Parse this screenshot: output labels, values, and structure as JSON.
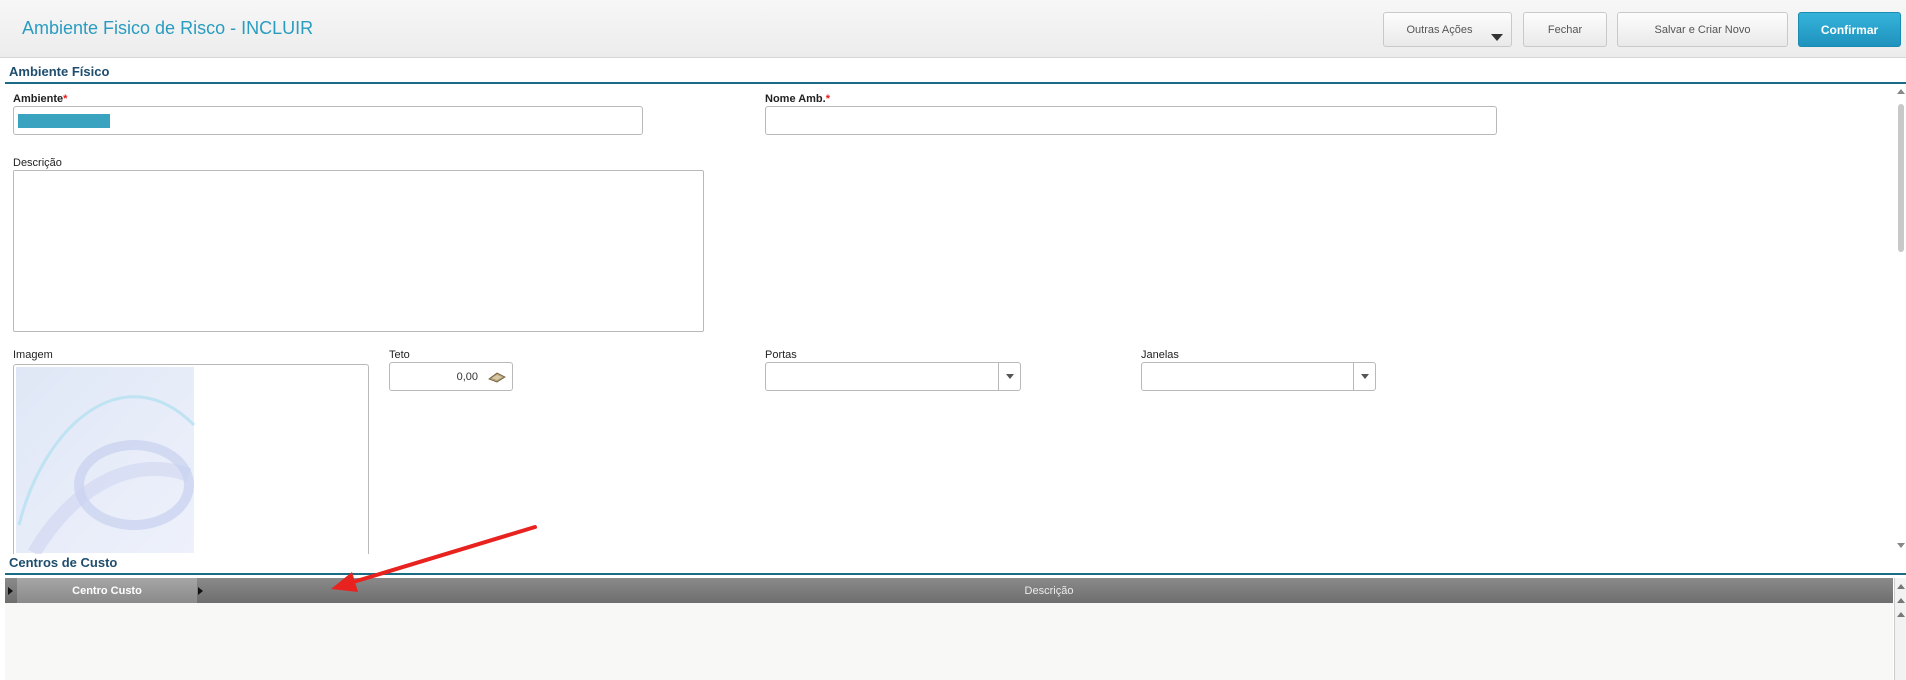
{
  "header": {
    "title": "Ambiente Fisico de Risco - INCLUIR",
    "buttons": {
      "outras_acoes": "Outras Ações",
      "fechar": "Fechar",
      "salvar_criar": "Salvar e Criar Novo",
      "confirmar": "Confirmar"
    },
    "colors": {
      "accent": "#2a9cc0",
      "primary_button": "#1e93bd"
    }
  },
  "ambiente_fisico": {
    "section_title": "Ambiente Físico",
    "required_marker": "*",
    "ambiente": {
      "label": "Ambiente",
      "value": ""
    },
    "nome_amb": {
      "label": "Nome Amb.",
      "value": ""
    },
    "descricao": {
      "label": "Descrição",
      "value": ""
    },
    "imagem": {
      "label": "Imagem"
    },
    "teto": {
      "label": "Teto",
      "value": "0,00",
      "icon": "calculator-icon"
    },
    "portas": {
      "label": "Portas",
      "value": ""
    },
    "janelas": {
      "label": "Janelas",
      "value": ""
    }
  },
  "centros_custo": {
    "section_title": "Centros de Custo",
    "columns": [
      "Centro Custo",
      "Descrição"
    ],
    "rows": []
  }
}
